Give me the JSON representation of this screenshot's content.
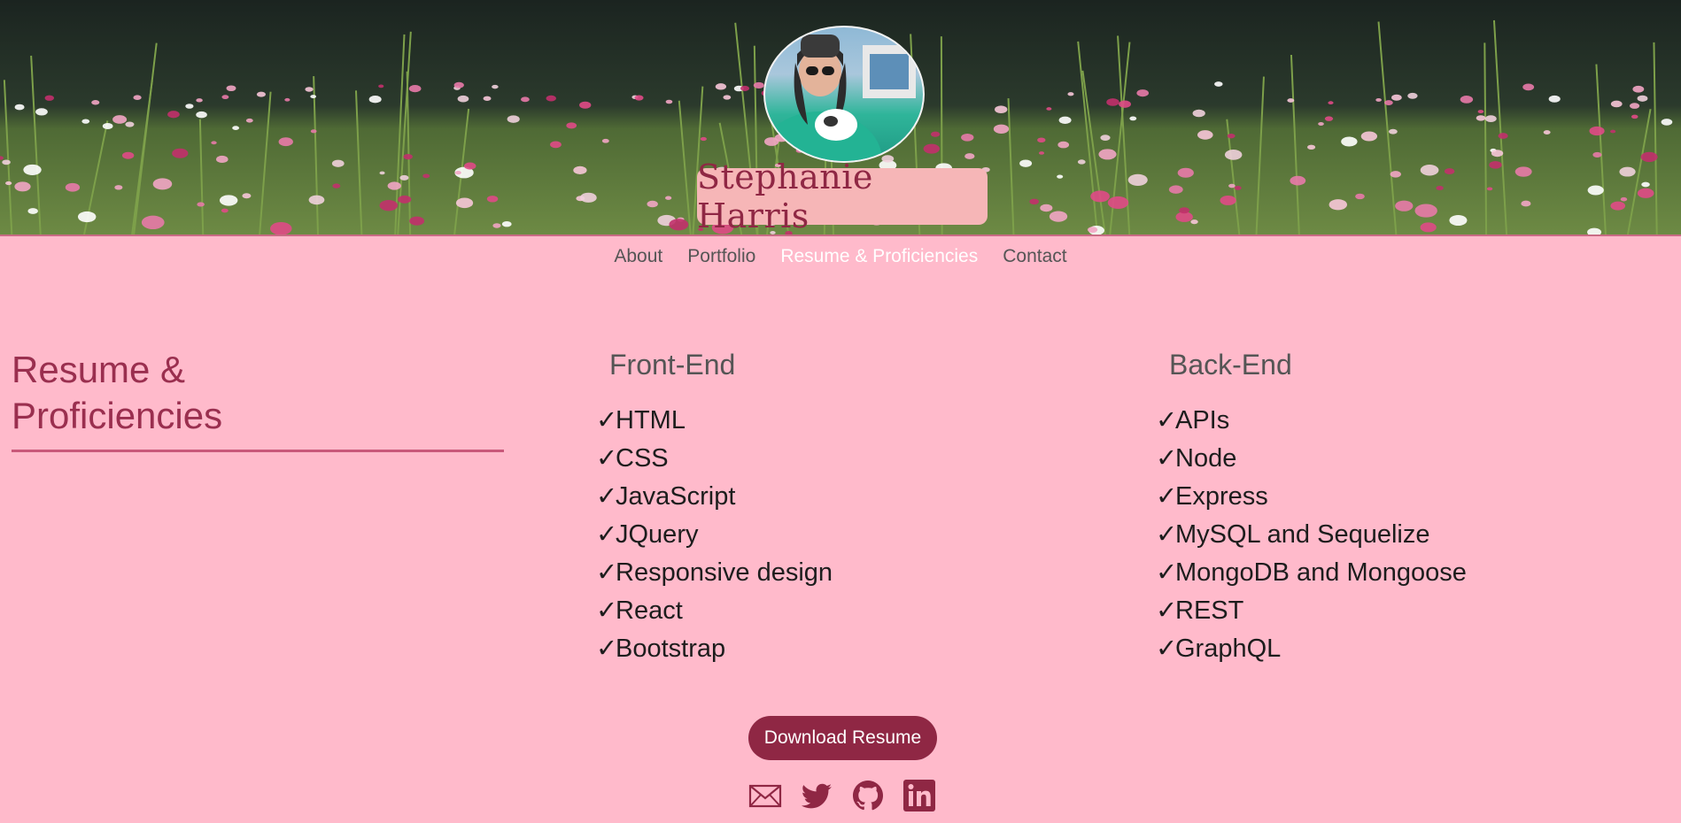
{
  "header": {
    "name": "Stephanie Harris"
  },
  "nav": {
    "items": [
      {
        "label": "About"
      },
      {
        "label": "Portfolio"
      },
      {
        "label": "Resume & Proficiencies"
      },
      {
        "label": "Contact"
      }
    ],
    "active": "Resume & Proficiencies"
  },
  "section": {
    "title_line1": "Resume &",
    "title_line2": "Proficiencies"
  },
  "front_end": {
    "heading": "Front-End",
    "items": [
      "HTML",
      "CSS",
      "JavaScript",
      "JQuery",
      "Responsive design",
      "React",
      "Bootstrap"
    ]
  },
  "back_end": {
    "heading": "Back-End",
    "items": [
      "APIs",
      "Node",
      "Express",
      "MySQL and Sequelize",
      "MongoDB and Mongoose",
      "REST",
      "GraphQL"
    ]
  },
  "check_glyph": "✓",
  "download": {
    "label": "Download Resume"
  },
  "socials": {
    "icons": [
      "email-icon",
      "twitter-icon",
      "github-icon",
      "linkedin-icon"
    ]
  },
  "colors": {
    "background": "#ffbacb",
    "accent": "#8f2744",
    "name_box": "#f6b6b7",
    "active_nav": "#ffffff"
  }
}
